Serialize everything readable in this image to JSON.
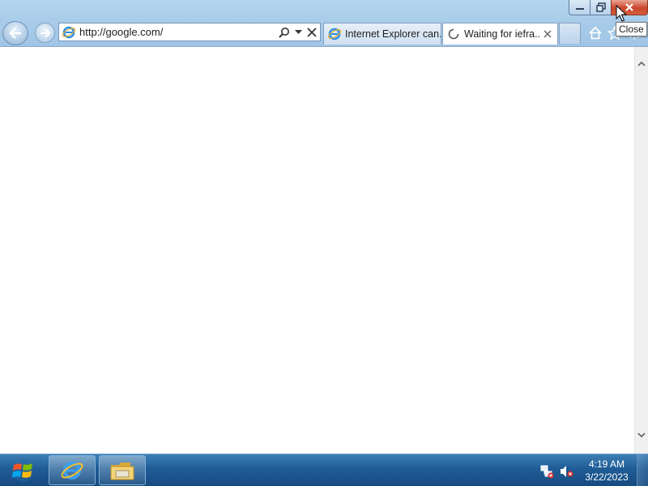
{
  "browser": {
    "address_url": "http://google.com/",
    "tabs": [
      {
        "label": "Internet Explorer can..."
      },
      {
        "label": "Waiting for iefra..."
      }
    ],
    "caption_tooltip": "Close"
  },
  "taskbar": {
    "time": "4:19 AM",
    "date": "3/22/2023"
  },
  "icons": {
    "back": "back-arrow-icon",
    "forward": "forward-arrow-icon",
    "ie": "ie-logo-icon",
    "search": "search-icon",
    "dropdown": "chevron-down-icon",
    "stop": "stop-icon",
    "home": "home-icon",
    "favorites": "star-icon",
    "tools": "gear-icon",
    "loading": "loading-spinner-icon",
    "close_tab": "close-icon",
    "windows_start": "windows-logo-icon",
    "explorer": "folder-icon",
    "network": "network-icon",
    "volume": "volume-muted-icon"
  },
  "colors": {
    "window_frame": "#a7cbe9",
    "close_button": "#c9462c",
    "taskbar": "#1f5c96"
  }
}
